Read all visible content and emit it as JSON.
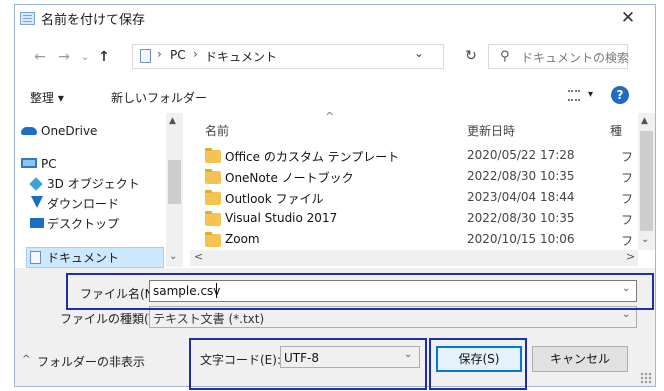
{
  "window": {
    "title": "名前を付けて保存",
    "close_glyph": "✕"
  },
  "navigation": {
    "back_glyph": "←",
    "forward_glyph": "→",
    "history_glyph": "⌄",
    "up_glyph": "↑",
    "breadcrumb": [
      "PC",
      "ドキュメント"
    ],
    "crumb_sep": "›",
    "address_dropdown": "⌄",
    "refresh_glyph": "↻",
    "search_glyph": "⚲",
    "search_placeholder": "ドキュメントの検索"
  },
  "toolbar": {
    "organize": "整理 ▾",
    "new_folder": "新しいフォルダー",
    "view_arrow": "▾",
    "help": "?"
  },
  "sidebar": {
    "items": [
      {
        "label": "OneDrive",
        "icon": "cloud-icon"
      },
      {
        "label": "PC",
        "icon": "computer-icon"
      },
      {
        "label": "3D オブジェクト",
        "icon": "cube-icon"
      },
      {
        "label": "ダウンロード",
        "icon": "download-icon"
      },
      {
        "label": "デスクトップ",
        "icon": "desktop-icon"
      },
      {
        "label": "ドキュメント",
        "icon": "document-icon",
        "selected": true
      }
    ],
    "scroll_up": "▲",
    "scroll_down": "⌄"
  },
  "file_list": {
    "columns": {
      "name": "名前",
      "modified": "更新日時",
      "type": "種"
    },
    "sort_glyph": "^",
    "rows": [
      {
        "name": "Office のカスタム テンプレート",
        "modified": "2020/05/22 17:28",
        "type": "フ"
      },
      {
        "name": "OneNote ノートブック",
        "modified": "2022/08/30 10:35",
        "type": "フ"
      },
      {
        "name": "Outlook ファイル",
        "modified": "2023/04/04 18:44",
        "type": "フ"
      },
      {
        "name": "Visual Studio 2017",
        "modified": "2022/08/30 10:35",
        "type": "フ"
      },
      {
        "name": "Zoom",
        "modified": "2020/10/15 10:06",
        "type": "フ"
      }
    ],
    "scroll_up": "▲",
    "scroll_down": "⌄",
    "scroll_left": "<",
    "scroll_right": ">"
  },
  "form": {
    "filename_label": "ファイル名(N):",
    "filename_value": "sample.csv",
    "filetype_label": "ファイルの種類(T):",
    "filetype_value": "テキスト文書 (*.txt)",
    "encoding_label": "文字コード(E):",
    "encoding_value": "UTF-8",
    "dropdown_arrow": "⌄"
  },
  "footer": {
    "hide_folders": "フォルダーの非表示",
    "hide_glyph": "^",
    "save": "保存(S)",
    "cancel": "キャンセル"
  },
  "colors": {
    "accent": "#0078d7",
    "highlight": "#1e2fa8",
    "folder": "#f4c453"
  }
}
